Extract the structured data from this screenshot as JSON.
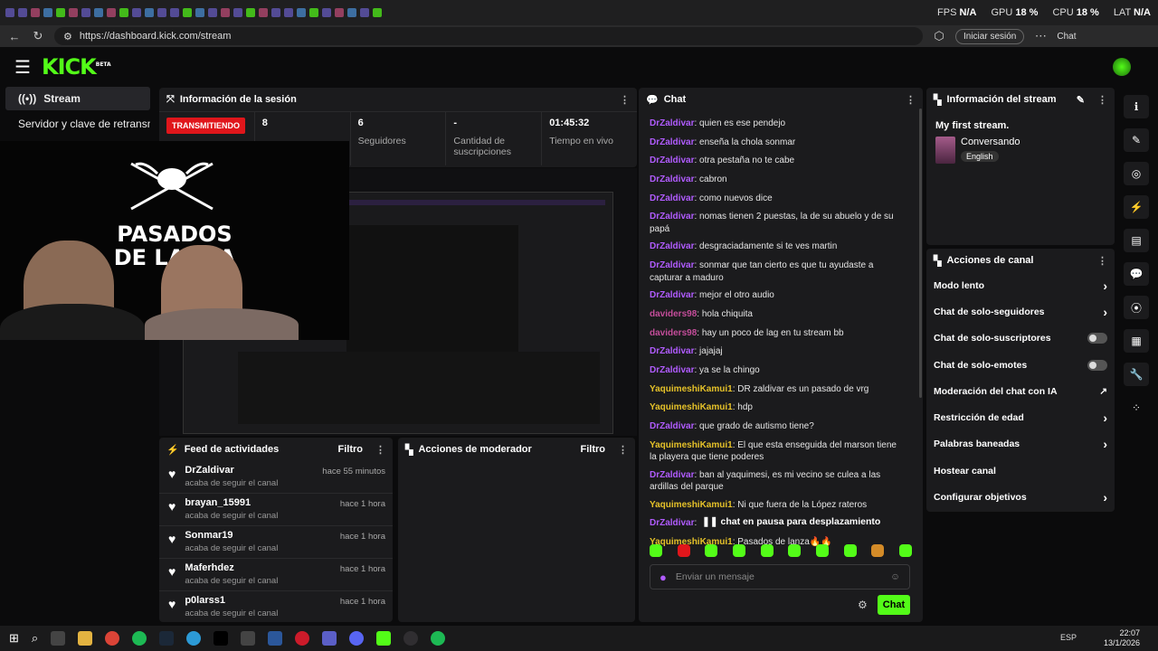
{
  "system": {
    "fps_label": "FPS",
    "fps_value": "N/A",
    "gpu_label": "GPU",
    "gpu_value": "18 %",
    "cpu_label": "CPU",
    "cpu_value": "18 %",
    "lat_label": "LAT",
    "lat_value": "N/A"
  },
  "browser": {
    "url": "https://dashboard.kick.com/stream",
    "signin_label": "Iniciar sesión",
    "copilot_label": "Chat"
  },
  "brand": {
    "logo": "KICK",
    "logo_badge": "BETA",
    "accent": "#53fc18"
  },
  "sidebar": {
    "items": [
      {
        "label": "Stream",
        "icon": "broadcast-icon"
      },
      {
        "label": "Servidor y clave de retransmisión"
      }
    ]
  },
  "session": {
    "title": "Información de la sesión",
    "status": "TRANSMITIENDO",
    "viewers": "8",
    "followers_value": "6",
    "followers_label": "Seguidores",
    "subs_value": "-",
    "subs_label": "Cantidad de suscripciones",
    "time_value": "01:45:32",
    "time_label": "Tiempo en vivo"
  },
  "camera_overlay": {
    "brand_text": "PASADOS DE LANZA"
  },
  "feed": {
    "title": "Feed de actividades",
    "filter": "Filtro",
    "items": [
      {
        "name": "DrZaldivar",
        "action": "acaba de seguir el canal",
        "time": "hace 55 minutos"
      },
      {
        "name": "brayan_15991",
        "action": "acaba de seguir el canal",
        "time": "hace 1 hora"
      },
      {
        "name": "Sonmar19",
        "action": "acaba de seguir el canal",
        "time": "hace 1 hora"
      },
      {
        "name": "Maferhdez",
        "action": "acaba de seguir el canal",
        "time": "hace 1 hora"
      },
      {
        "name": "p0larss1",
        "action": "acaba de seguir el canal",
        "time": "hace 1 hora"
      }
    ]
  },
  "moderator": {
    "title": "Acciones de moderador",
    "filter": "Filtro"
  },
  "chat": {
    "title": "Chat",
    "messages": [
      {
        "user": "DrZaldivar",
        "text": "quien es ese pendejo",
        "color": "#b15cff"
      },
      {
        "user": "DrZaldivar",
        "text": "enseña la chola sonmar",
        "color": "#b15cff"
      },
      {
        "user": "DrZaldivar",
        "text": "otra pestaña no te cabe",
        "color": "#b15cff"
      },
      {
        "user": "DrZaldivar",
        "text": "cabron",
        "color": "#b15cff"
      },
      {
        "user": "DrZaldivar",
        "text": "como nuevos dice",
        "color": "#b15cff"
      },
      {
        "user": "DrZaldivar",
        "text": "nomas tienen 2 puestas, la de su abuelo y de su papá",
        "color": "#b15cff"
      },
      {
        "user": "DrZaldivar",
        "text": "desgraciadamente si te ves martin",
        "color": "#b15cff"
      },
      {
        "user": "DrZaldivar",
        "text": "sonmar que tan cierto es que tu ayudaste a capturar a maduro",
        "color": "#b15cff"
      },
      {
        "user": "DrZaldivar",
        "text": "mejor el otro audio",
        "color": "#b15cff"
      },
      {
        "user": "daviders98",
        "text": "hola chiquita",
        "color": "#c44d9a"
      },
      {
        "user": "daviders98",
        "text": "hay un poco de lag en tu stream bb",
        "color": "#c44d9a"
      },
      {
        "user": "DrZaldivar",
        "text": "jajajaj",
        "color": "#b15cff"
      },
      {
        "user": "DrZaldivar",
        "text": "ya se la chingo",
        "color": "#b15cff"
      },
      {
        "user": "YaquimeshiKamui1",
        "text": "DR zaldivar es un pasado de vrg",
        "color": "#e6c229"
      },
      {
        "user": "YaquimeshiKamui1",
        "text": "hdp",
        "color": "#e6c229"
      },
      {
        "user": "DrZaldivar",
        "text": "que grado de autismo tiene?",
        "color": "#b15cff"
      },
      {
        "user": "YaquimeshiKamui1",
        "text": "El que esta enseguida del marson tiene la playera que tiene poderes",
        "color": "#e6c229"
      },
      {
        "user": "DrZaldivar",
        "text": "ban al yaquimesi, es mi vecino se culea a las ardillas del parque",
        "color": "#b15cff"
      },
      {
        "user": "YaquimeshiKamui1",
        "text": "Ni que fuera de la López rateros",
        "color": "#e6c229"
      },
      {
        "user": "DrZaldivar",
        "text": "",
        "color": "#b15cff"
      },
      {
        "user": "YaquimeshiKamui1",
        "text": "Pasados de lanza🔥🔥",
        "color": "#e6c229"
      }
    ],
    "paused_notice": "chat en pausa para desplazamiento",
    "input_placeholder": "Enviar un mensaje",
    "send_label": "Chat"
  },
  "stream_info": {
    "title": "Información del stream",
    "stream_title": "My first stream.",
    "category": "Conversando",
    "language": "English"
  },
  "channel_actions": {
    "title": "Acciones de canal",
    "items": [
      {
        "label": "Modo lento",
        "control": "chevron"
      },
      {
        "label": "Chat de solo-seguidores",
        "control": "chevron"
      },
      {
        "label": "Chat de solo-suscriptores",
        "control": "toggle"
      },
      {
        "label": "Chat de solo-emotes",
        "control": "toggle"
      },
      {
        "label": "Moderación del chat con IA",
        "control": "external"
      },
      {
        "label": "Restricción de edad",
        "control": "chevron"
      },
      {
        "label": "Palabras baneadas",
        "control": "chevron"
      },
      {
        "label": "Hostear canal",
        "control": "none"
      },
      {
        "label": "Configurar objetivos",
        "control": "chevron"
      }
    ]
  },
  "taskbar": {
    "lang": "ESP",
    "time": "22:07",
    "date": "13/1/2026"
  }
}
